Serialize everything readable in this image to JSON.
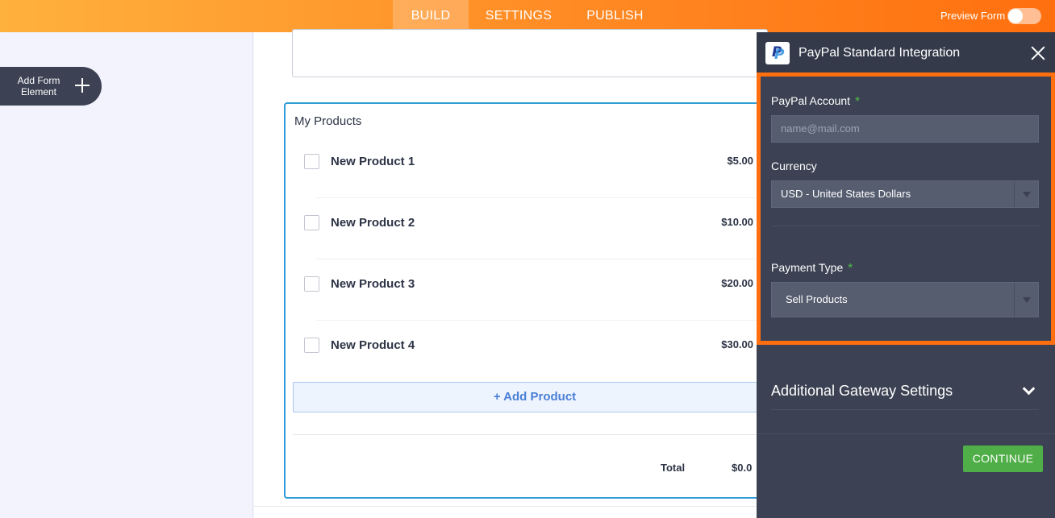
{
  "topbar": {
    "tabs": [
      {
        "label": "BUILD",
        "active": true
      },
      {
        "label": "SETTINGS",
        "active": false
      },
      {
        "label": "PUBLISH",
        "active": false
      }
    ],
    "preview_label": "Preview Form",
    "preview_on": false
  },
  "sidebar": {
    "add_element_label": "Add Form Element"
  },
  "form": {
    "products": {
      "title": "My Products",
      "items": [
        {
          "name": "New Product 1",
          "price": "$5.00"
        },
        {
          "name": "New Product 2",
          "price": "$10.00"
        },
        {
          "name": "New Product 3",
          "price": "$20.00"
        },
        {
          "name": "New Product 4",
          "price": "$30.00"
        }
      ],
      "add_product_label": "+ Add Product",
      "total_label": "Total",
      "total_value": "$0.0"
    }
  },
  "panel": {
    "title": "PayPal Standard Integration",
    "paypal_account": {
      "label": "PayPal Account",
      "required_mark": "*",
      "placeholder": "name@mail.com"
    },
    "currency": {
      "label": "Currency",
      "value": "USD - United States Dollars"
    },
    "payment_type": {
      "label": "Payment Type",
      "required_mark": "*",
      "value": "Sell Products"
    },
    "gateway_settings_label": "Additional Gateway Settings",
    "continue_label": "CONTINUE"
  },
  "colors": {
    "accent_orange": "#ff6f0f",
    "panel_bg": "#3c4253",
    "continue_green": "#4fae47",
    "product_border": "#2f9bd7"
  }
}
